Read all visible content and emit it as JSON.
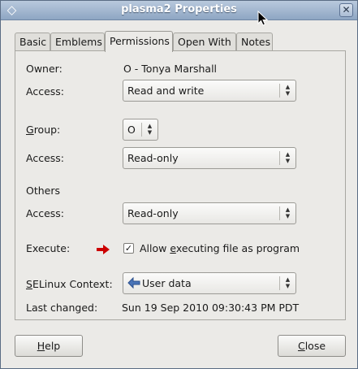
{
  "window": {
    "title": "plasma2 Properties",
    "menu_icon": "diamond-icon",
    "close_icon": "close-icon"
  },
  "tabs": [
    {
      "label": "Basic"
    },
    {
      "label": "Emblems"
    },
    {
      "label": "Permissions"
    },
    {
      "label": "Open With"
    },
    {
      "label": "Notes"
    }
  ],
  "active_tab": "Permissions",
  "owner": {
    "label": "Owner:",
    "value": "O - Tonya Marshall"
  },
  "owner_access": {
    "label": "Access:",
    "value": "Read and write"
  },
  "group": {
    "label_pre": "",
    "label_ul": "G",
    "label_post": "roup:",
    "value": "O"
  },
  "group_access": {
    "label": "Access:",
    "value": "Read-only"
  },
  "others": {
    "label": "Others"
  },
  "others_access": {
    "label": "Access:",
    "value": "Read-only"
  },
  "execute": {
    "label": "Execute:",
    "checked": true,
    "check_pre": "Allow ",
    "check_ul": "e",
    "check_post": "xecuting file as program",
    "arrow_color": "#cc0000"
  },
  "selinux": {
    "label_ul": "S",
    "label_post": "ELinux Context:",
    "value": "User data",
    "icon": "back-arrow-icon"
  },
  "last_changed": {
    "label": "Last changed:",
    "value": "Sun 19 Sep 2010 09:30:43 PM PDT"
  },
  "buttons": {
    "help_ul": "H",
    "help_post": "elp",
    "close_ul": "C",
    "close_post": "lose"
  }
}
